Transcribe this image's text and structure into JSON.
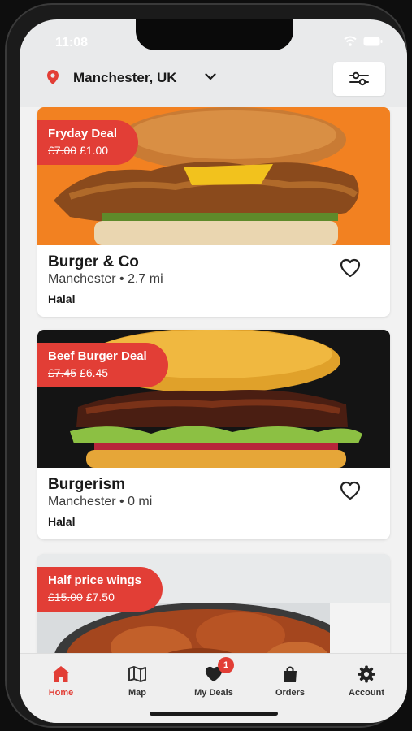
{
  "status_bar": {
    "time": "11:08"
  },
  "header": {
    "location": "Manchester, UK"
  },
  "listings": [
    {
      "deal_title": "Fryday Deal",
      "old_price": "£7.00",
      "new_price": "£1.00",
      "name": "Burger & Co",
      "meta": "Manchester • 2.7 mi",
      "tag": "Halal"
    },
    {
      "deal_title": "Beef Burger Deal",
      "old_price": "£7.45",
      "new_price": "£6.45",
      "name": "Burgerism",
      "meta": "Manchester • 0 mi",
      "tag": "Halal"
    },
    {
      "deal_title": "Half price wings",
      "old_price": "£15.00",
      "new_price": "£7.50",
      "name": "",
      "meta": "",
      "tag": ""
    }
  ],
  "tabbar": {
    "home": "Home",
    "map": "Map",
    "deals": "My Deals",
    "deals_badge": "1",
    "orders": "Orders",
    "account": "Account"
  },
  "colors": {
    "accent": "#e23e36",
    "background": "#e9eaeb"
  }
}
